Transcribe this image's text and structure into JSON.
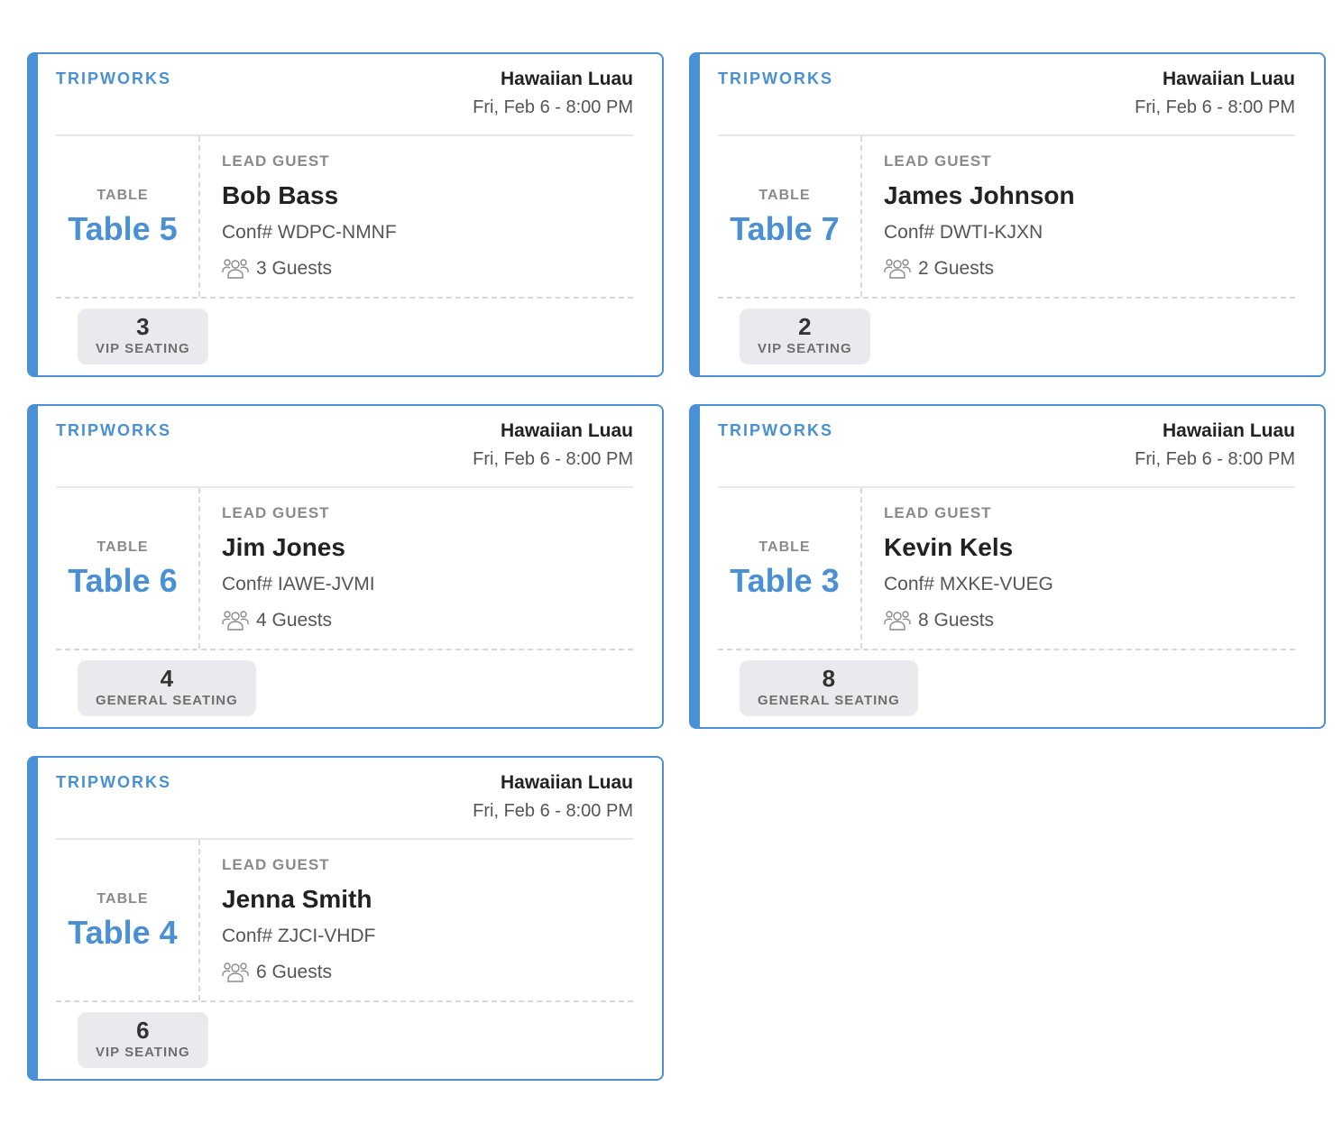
{
  "cards": [
    {
      "brand": "TRIPWORKS",
      "event_name": "Hawaiian Luau",
      "event_date": "Fri, Feb 6 - 8:00 PM",
      "table_caption": "TABLE",
      "table_name": "Table 5",
      "lead_caption": "LEAD GUEST",
      "lead_name": "Bob Bass",
      "conf": "Conf# WDPC-NMNF",
      "guests": "3 Guests",
      "badge_count": "3",
      "badge_label": "VIP SEATING",
      "guests_icon": "people-icon"
    },
    {
      "brand": "TRIPWORKS",
      "event_name": "Hawaiian Luau",
      "event_date": "Fri, Feb 6 - 8:00 PM",
      "table_caption": "TABLE",
      "table_name": "Table 7",
      "lead_caption": "LEAD GUEST",
      "lead_name": "James Johnson",
      "conf": "Conf# DWTI-KJXN",
      "guests": "2 Guests",
      "badge_count": "2",
      "badge_label": "VIP SEATING",
      "guests_icon": "people-icon"
    },
    {
      "brand": "TRIPWORKS",
      "event_name": "Hawaiian Luau",
      "event_date": "Fri, Feb 6 - 8:00 PM",
      "table_caption": "TABLE",
      "table_name": "Table 6",
      "lead_caption": "LEAD GUEST",
      "lead_name": "Jim Jones",
      "conf": "Conf# IAWE-JVMI",
      "guests": "4 Guests",
      "badge_count": "4",
      "badge_label": "GENERAL SEATING",
      "guests_icon": "people-icon"
    },
    {
      "brand": "TRIPWORKS",
      "event_name": "Hawaiian Luau",
      "event_date": "Fri, Feb 6 - 8:00 PM",
      "table_caption": "TABLE",
      "table_name": "Table 3",
      "lead_caption": "LEAD GUEST",
      "lead_name": "Kevin Kels",
      "conf": "Conf# MXKE-VUEG",
      "guests": "8 Guests",
      "badge_count": "8",
      "badge_label": "GENERAL SEATING",
      "guests_icon": "people-icon"
    },
    {
      "brand": "TRIPWORKS",
      "event_name": "Hawaiian Luau",
      "event_date": "Fri, Feb 6 - 8:00 PM",
      "table_caption": "TABLE",
      "table_name": "Table 4",
      "lead_caption": "LEAD GUEST",
      "lead_name": "Jenna Smith",
      "conf": "Conf# ZJCI-VHDF",
      "guests": "6 Guests",
      "badge_count": "6",
      "badge_label": "VIP SEATING",
      "guests_icon": "people-icon"
    }
  ],
  "colors": {
    "accent": "#4a90d4",
    "badge_bg": "#e9eaed",
    "muted_text": "#8a8a8a"
  }
}
